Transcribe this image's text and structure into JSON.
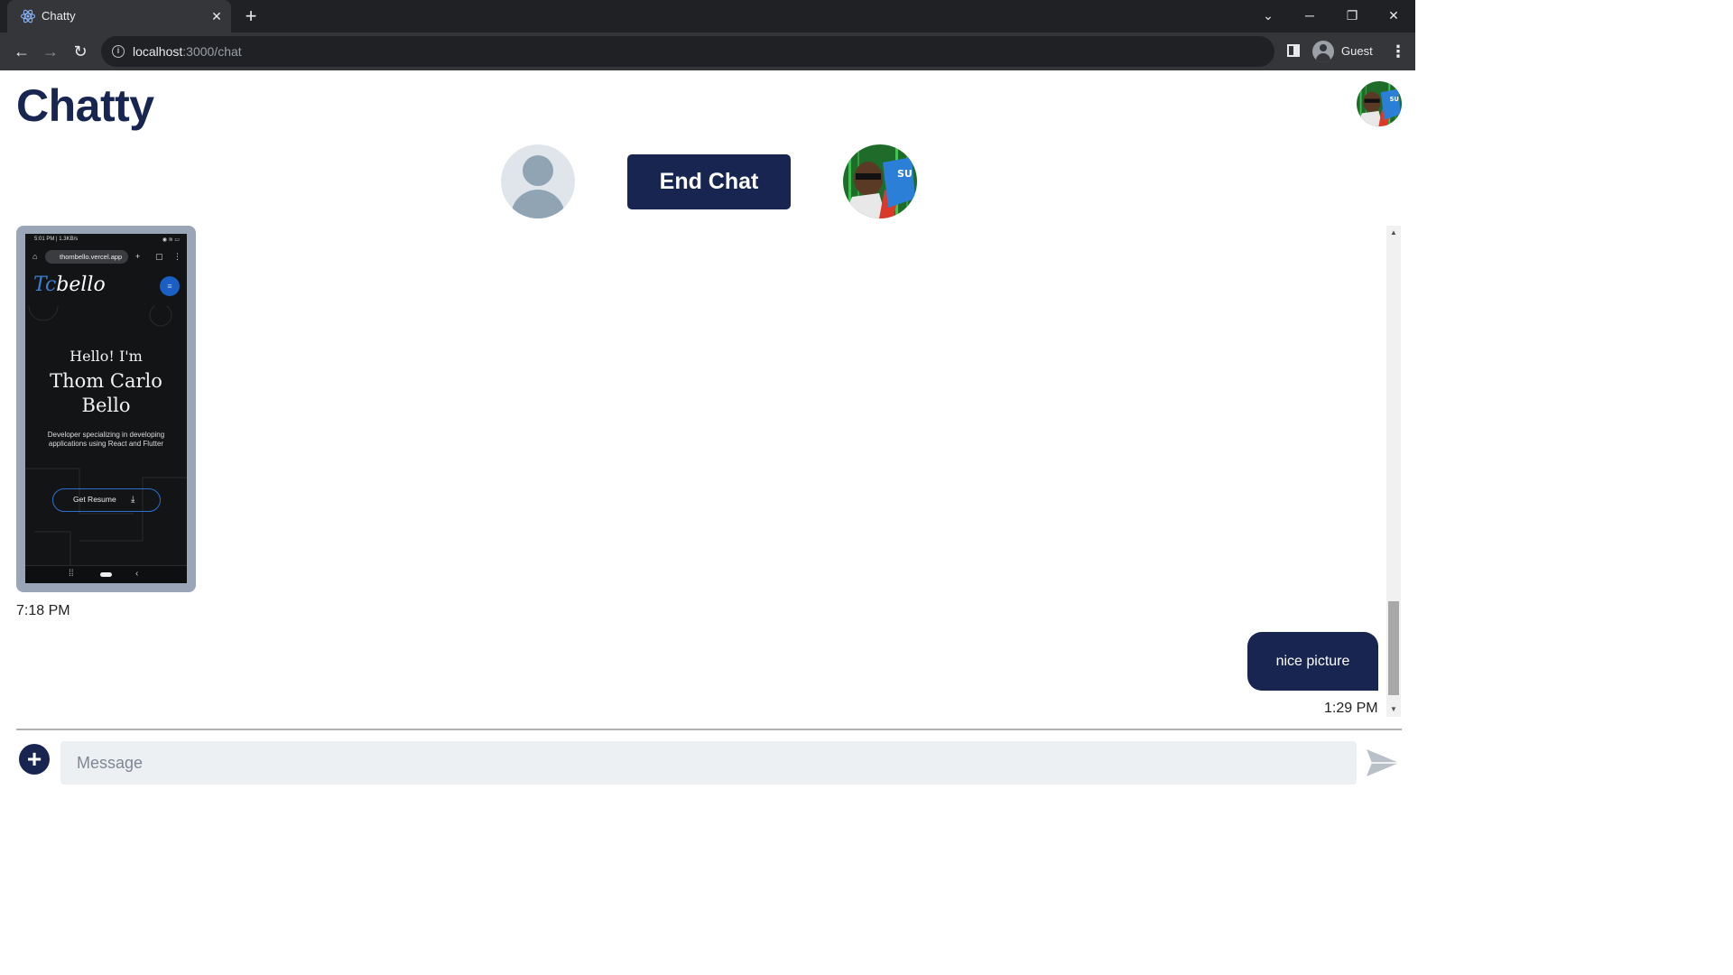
{
  "browser": {
    "tab_title": "Chatty",
    "url_host": "localhost",
    "url_path": ":3000/chat",
    "profile_label": "Guest"
  },
  "app": {
    "title": "Chatty",
    "end_chat_label": "End Chat"
  },
  "chat": {
    "messages": [
      {
        "type": "image",
        "timestamp": "7:18 PM",
        "screenshot": {
          "status_time": "5:01 PM | 1.3KB/s",
          "url": "thombello.vercel.app",
          "logo_prefix": "Tc",
          "logo_suffix": "bello",
          "greeting": "Hello! I'm",
          "name": "Thom Carlo Bello",
          "description": "Developer specializing in developing applications using React and Flutter",
          "button_label": "Get Resume"
        }
      },
      {
        "type": "text",
        "text": "nice picture",
        "timestamp": "1:29 PM"
      }
    ]
  },
  "composer": {
    "placeholder": "Message",
    "value": ""
  },
  "colors": {
    "brand": "#172550",
    "bubble": "#172550",
    "input_bg": "#edf0f3"
  }
}
